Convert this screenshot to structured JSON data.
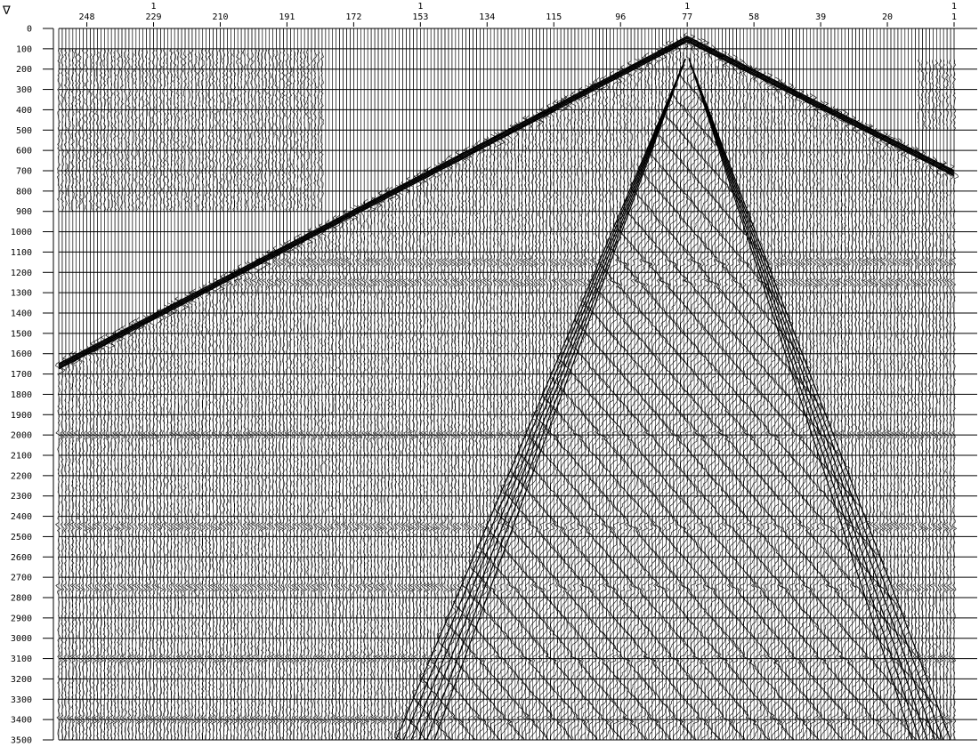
{
  "chart_data": {
    "type": "seismic_wiggle_section",
    "title": "",
    "xlabel": "",
    "ylabel": "",
    "corner_marker": "∇",
    "x_header_row1": [
      {
        "label": "1",
        "trace": 229
      },
      {
        "label": "1",
        "trace": 153
      },
      {
        "label": "1",
        "trace": 77
      },
      {
        "label": "1",
        "trace": 1
      }
    ],
    "x_header_row2": [
      248,
      229,
      210,
      191,
      172,
      153,
      134,
      115,
      96,
      77,
      58,
      39,
      20,
      1
    ],
    "x_range": [
      256,
      1
    ],
    "y_ticks": [
      0,
      100,
      200,
      300,
      400,
      500,
      600,
      700,
      800,
      900,
      1000,
      1100,
      1200,
      1300,
      1400,
      1500,
      1600,
      1700,
      1800,
      1900,
      2000,
      2100,
      2200,
      2300,
      2400,
      2500,
      2600,
      2700,
      2800,
      2900,
      3000,
      3100,
      3200,
      3300,
      3400,
      3500
    ],
    "y_range": [
      0,
      3500
    ],
    "y_reversed": true,
    "grid": true,
    "features": {
      "apex_trace": 77,
      "apex_time": 40,
      "direct_wave_left": {
        "from_trace": 77,
        "from_time": 40,
        "to_trace": 256,
        "to_time": 1650
      },
      "direct_wave_right": {
        "from_trace": 77,
        "from_time": 40,
        "to_trace": 1,
        "to_time": 700
      },
      "ground_roll_cone": {
        "apex_trace": 77,
        "apex_time": 150,
        "left_edge_trace_at_3500": 160,
        "right_edge_trace_at_3500": 2
      },
      "reflector_times": [
        1150,
        1250,
        2000,
        2450,
        2750,
        3100,
        3400
      ]
    }
  },
  "colors": {
    "ink": "#000000",
    "background": "#ffffff"
  }
}
